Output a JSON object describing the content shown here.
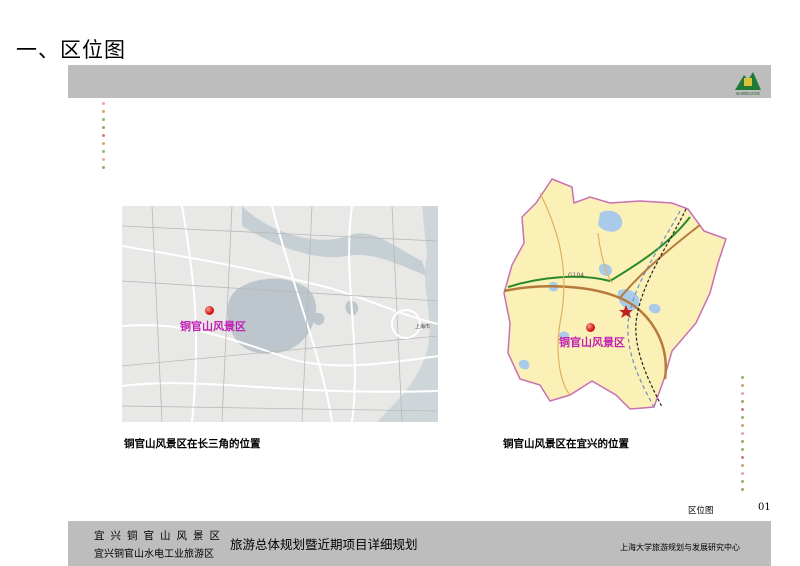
{
  "page": {
    "title": "一、区位图",
    "logo_label": "宜兴铜官山风景区"
  },
  "maps": {
    "left": {
      "site_label": "铜官山风景区",
      "city_label": "上海市",
      "caption": "铜官山风景区在长三角的位置"
    },
    "right": {
      "site_label": "铜官山风景区",
      "road_label": "G104",
      "caption": "铜官山风景区在宜兴的位置"
    }
  },
  "section_label": "区位图",
  "page_number": "01",
  "footer": {
    "line1": "宜兴铜官山风景区",
    "line2": "宜兴铜官山水电工业旅游区",
    "plan_title": "旅游总体规划暨近期项目详细规划",
    "institute": "上海大学旅游规划与发展研究中心"
  },
  "colors": {
    "bar_gray": "#bdbdbd",
    "label_magenta": "#c21fb4",
    "map_land": "#fbf1b6",
    "map_water": "#a9cbe9",
    "map_border": "#c96fb5",
    "dot_palette": [
      "#e8a6a3",
      "#c9a86b",
      "#8db86b",
      "#a3a26f",
      "#d07b78"
    ]
  },
  "icons": {
    "logo": "mountain-logo-icon",
    "site_marker": "red-pin-icon",
    "star": "red-star-icon"
  }
}
